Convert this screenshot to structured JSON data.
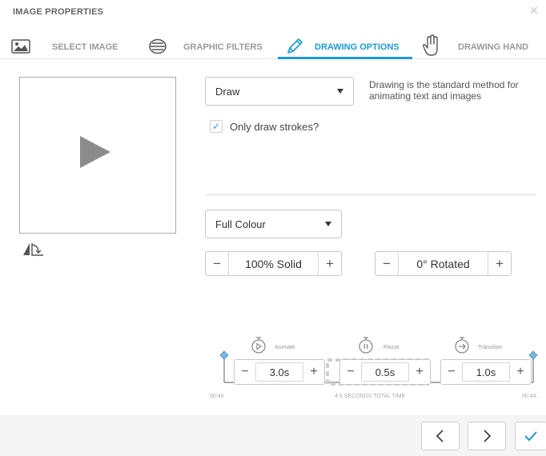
{
  "window": {
    "title": "IMAGE PROPERTIES",
    "close_glyph": "×"
  },
  "tabs": [
    {
      "label": "SELECT IMAGE",
      "icon": "image-icon",
      "active": false
    },
    {
      "label": "GRAPHIC FILTERS",
      "icon": "filter-lines-icon",
      "active": false
    },
    {
      "label": "DRAWING OPTIONS",
      "icon": "pencil-icon",
      "active": true
    },
    {
      "label": "DRAWING HAND",
      "icon": "hand-icon",
      "active": false
    }
  ],
  "accent_color": "#1a9bd7",
  "draw_mode": {
    "selected": "Draw",
    "description": "Drawing is the standard method for animating text and images"
  },
  "only_draw_strokes": {
    "label": "Only draw strokes?",
    "checked": true,
    "check_glyph": "✓"
  },
  "colour_mode": {
    "selected": "Full Colour"
  },
  "opacity": {
    "value": "100% Solid",
    "minus": "−",
    "plus": "+"
  },
  "rotation": {
    "value": "0° Rotated",
    "minus": "−",
    "plus": "+"
  },
  "timeline": {
    "animate": {
      "label": "Animate",
      "value": "3.0s",
      "minus": "−",
      "plus": "+"
    },
    "pause": {
      "label": "Pause",
      "value": "0.5s",
      "minus": "−",
      "plus": "+"
    },
    "transition": {
      "label": "Transition",
      "value": "1.0s",
      "minus": "−",
      "plus": "+"
    },
    "start_time": "00:40",
    "total_time": "4.5 SECONDS TOTAL TIME",
    "end_time": "00:44."
  },
  "footer": {
    "prev_glyph": "‹",
    "next_glyph": "›",
    "confirm_glyph": "✓"
  }
}
